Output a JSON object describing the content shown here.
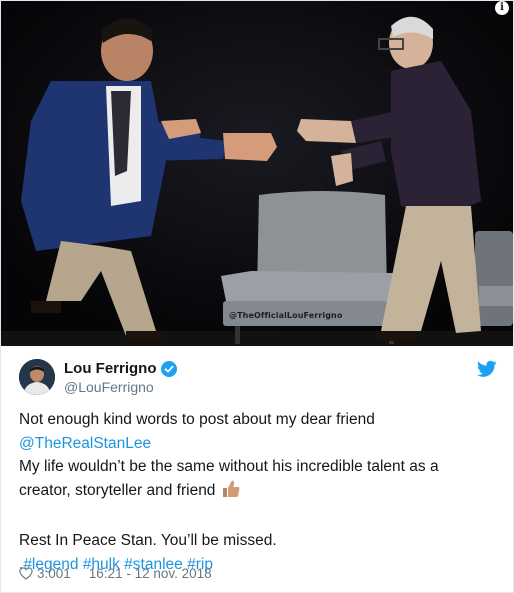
{
  "photo": {
    "watermark": "@TheOfficialLouFerrigno",
    "info_icon": "info-icon"
  },
  "author": {
    "display_name": "Lou Ferrigno",
    "handle": "@LouFerrigno",
    "verified": true
  },
  "tweet": {
    "line1": "Not enough kind words to post about my dear friend",
    "mention": "@TheRealStanLee",
    "line3": "My life wouldn’t be the same without his incredible talent as a",
    "line4": "creator, storyteller and friend",
    "thumb_icon": "thumbs-up-emoji",
    "line5": "Rest In Peace Stan. You’ll be missed.",
    "hashtag_prefix": ".",
    "hashtags": [
      "#legend",
      "#hulk",
      "#stanlee",
      "#rip"
    ]
  },
  "footer": {
    "likes": "3.001",
    "timestamp": "16:21 - 12 nov. 2018"
  },
  "colors": {
    "link": "#1b95e0",
    "muted": "#657786",
    "twitter_blue": "#1da1f2"
  }
}
